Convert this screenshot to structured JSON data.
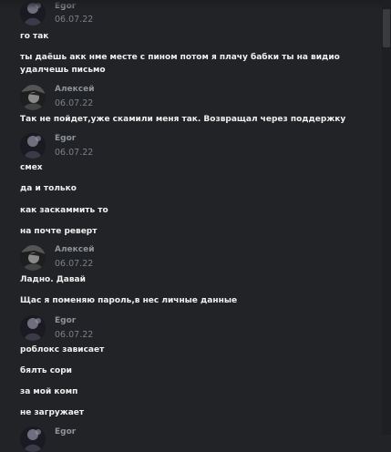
{
  "messages": [
    {
      "author": "Egor",
      "time": "06.07.22",
      "lines": [
        "го так",
        "ты даёшь акк нме месте с пином потом я плачу бабки ты на видио удалчешь письмо"
      ]
    },
    {
      "author": "Алексей",
      "time": "06.07.22",
      "lines": [
        "Так не пойдет,уже скамили меня так. Возвращал через поддержку"
      ]
    },
    {
      "author": "Egor",
      "time": "06.07.22",
      "lines": [
        "смех",
        "да и только",
        "как заскаммить то",
        "на почте реверт"
      ]
    },
    {
      "author": "Алексей",
      "time": "06.07.22",
      "lines": [
        "Ладно. Давай",
        "Щас я поменяю пароль,в нес личные данные"
      ]
    },
    {
      "author": "Egor",
      "time": "06.07.22",
      "lines": [
        "роблокс зависает",
        "бялть сори",
        "за мой комп",
        "не загружает"
      ]
    },
    {
      "author": "Egor",
      "time": "",
      "lines": []
    }
  ],
  "icons": {
    "egor_avatar": "avatar-egor-icon",
    "aleksey_avatar": "avatar-aleksey-icon"
  }
}
